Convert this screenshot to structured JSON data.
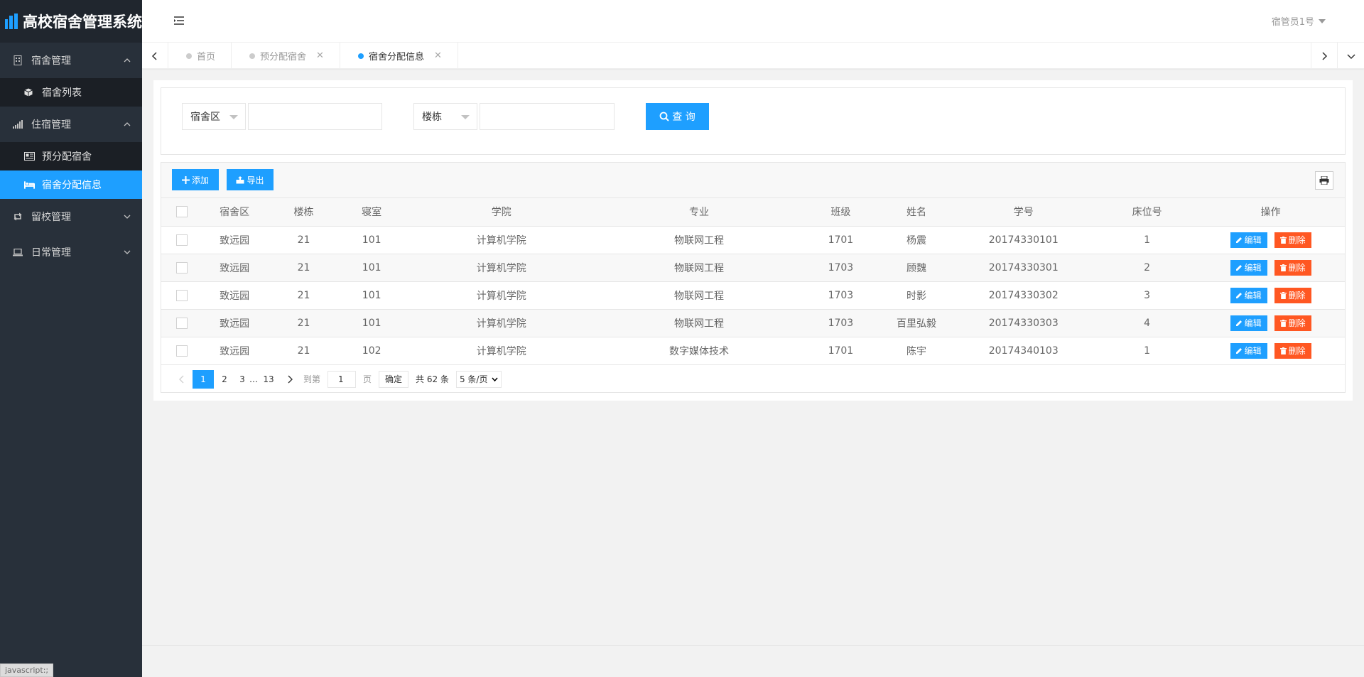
{
  "app": {
    "title": "高校宿舍管理系统"
  },
  "sidebar": {
    "groups": [
      {
        "label": "宿舍管理",
        "icon": "building-icon",
        "expanded": true,
        "items": [
          {
            "label": "宿舍列表",
            "icon": "cube-icon",
            "active": false
          }
        ]
      },
      {
        "label": "住宿管理",
        "icon": "signal-icon",
        "expanded": true,
        "items": [
          {
            "label": "预分配宿舍",
            "icon": "newspaper-icon",
            "active": false
          },
          {
            "label": "宿舍分配信息",
            "icon": "bed-icon",
            "active": true
          }
        ]
      },
      {
        "label": "留校管理",
        "icon": "retweet-icon",
        "expanded": false,
        "items": []
      },
      {
        "label": "日常管理",
        "icon": "laptop-icon",
        "expanded": false,
        "items": []
      }
    ]
  },
  "header": {
    "user": "宿管员1号"
  },
  "tabs": [
    {
      "label": "首页",
      "closable": false,
      "active": false
    },
    {
      "label": "预分配宿舍",
      "closable": true,
      "active": false
    },
    {
      "label": "宿舍分配信息",
      "closable": true,
      "active": true
    }
  ],
  "search": {
    "area_select": "宿舍区",
    "building_select": "楼栋",
    "area_value": "",
    "building_value": "",
    "button": "查 询"
  },
  "toolbar": {
    "add": "添加",
    "export": "导出"
  },
  "table": {
    "columns": [
      "宿舍区",
      "楼栋",
      "寝室",
      "学院",
      "专业",
      "班级",
      "姓名",
      "学号",
      "床位号",
      "操作"
    ],
    "rows": [
      [
        "致远园",
        "21",
        "101",
        "计算机学院",
        "物联网工程",
        "1701",
        "杨震",
        "20174330101",
        "1"
      ],
      [
        "致远园",
        "21",
        "101",
        "计算机学院",
        "物联网工程",
        "1703",
        "顾魏",
        "20174330301",
        "2"
      ],
      [
        "致远园",
        "21",
        "101",
        "计算机学院",
        "物联网工程",
        "1703",
        "时影",
        "20174330302",
        "3"
      ],
      [
        "致远园",
        "21",
        "101",
        "计算机学院",
        "物联网工程",
        "1703",
        "百里弘毅",
        "20174330303",
        "4"
      ],
      [
        "致远园",
        "21",
        "102",
        "计算机学院",
        "数字媒体技术",
        "1701",
        "陈宇",
        "20174340103",
        "1"
      ]
    ],
    "edit_label": "编辑",
    "delete_label": "删除"
  },
  "pagination": {
    "pages": [
      "1",
      "2",
      "3"
    ],
    "ellipsis": "…",
    "last": "13",
    "current": "1",
    "goto_label": "到第",
    "goto_value": "1",
    "page_suffix": "页",
    "confirm": "确定",
    "total": "共 62 条",
    "limit": "5 条/页"
  },
  "status_bar": "javascript:;",
  "colors": {
    "primary": "#1e9fff",
    "danger": "#ff5722",
    "sidebar": "#28303a"
  }
}
